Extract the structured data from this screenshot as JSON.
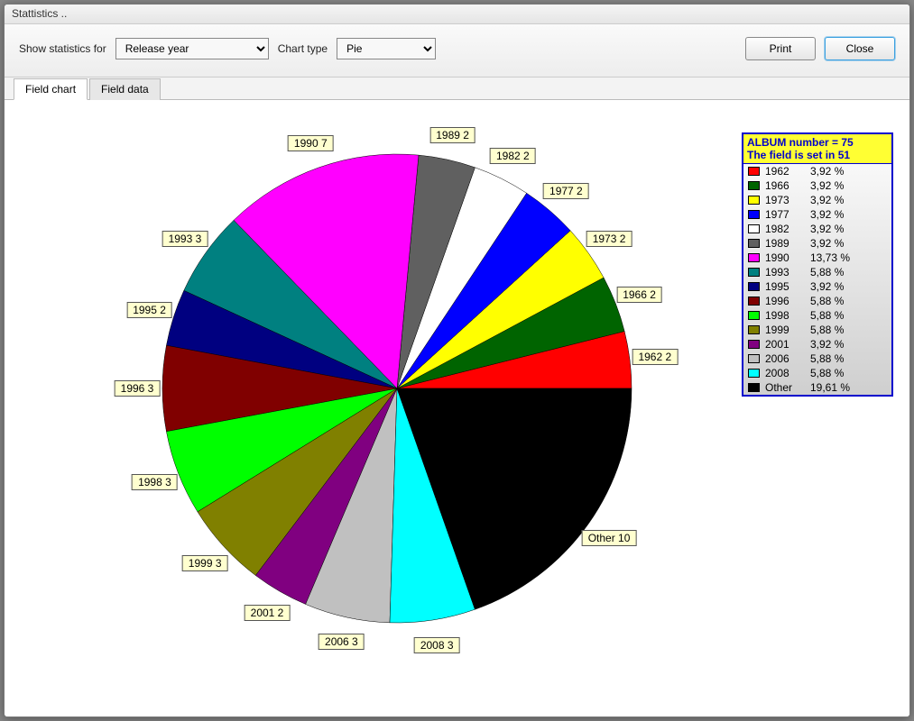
{
  "window": {
    "title": "Stattistics .."
  },
  "toolbar": {
    "stats_label": "Show statistics for",
    "stats_value": "Release year",
    "chart_type_label": "Chart type",
    "chart_type_value": "Pie",
    "print_label": "Print",
    "close_label": "Close"
  },
  "tabs": {
    "chart": "Field chart",
    "data": "Field data"
  },
  "legend_header": {
    "line1": "ALBUM number = 75",
    "line2": "The field is set in 51"
  },
  "chart_data": {
    "type": "pie",
    "title": "",
    "series": [
      {
        "name": "1962",
        "count": 2,
        "percent": "3,92 %",
        "color": "#ff0000"
      },
      {
        "name": "1966",
        "count": 2,
        "percent": "3,92 %",
        "color": "#006400"
      },
      {
        "name": "1973",
        "count": 2,
        "percent": "3,92 %",
        "color": "#ffff00"
      },
      {
        "name": "1977",
        "count": 2,
        "percent": "3,92 %",
        "color": "#0000ff"
      },
      {
        "name": "1982",
        "count": 2,
        "percent": "3,92 %",
        "color": "#ffffff"
      },
      {
        "name": "1989",
        "count": 2,
        "percent": "3,92 %",
        "color": "#606060"
      },
      {
        "name": "1990",
        "count": 7,
        "percent": "13,73 %",
        "color": "#ff00ff"
      },
      {
        "name": "1993",
        "count": 3,
        "percent": "5,88 %",
        "color": "#008080"
      },
      {
        "name": "1995",
        "count": 2,
        "percent": "3,92 %",
        "color": "#000080"
      },
      {
        "name": "1996",
        "count": 3,
        "percent": "5,88 %",
        "color": "#800000"
      },
      {
        "name": "1998",
        "count": 3,
        "percent": "5,88 %",
        "color": "#00ff00"
      },
      {
        "name": "1999",
        "count": 3,
        "percent": "5,88 %",
        "color": "#808000"
      },
      {
        "name": "2001",
        "count": 2,
        "percent": "3,92 %",
        "color": "#800080"
      },
      {
        "name": "2006",
        "count": 3,
        "percent": "5,88 %",
        "color": "#c0c0c0"
      },
      {
        "name": "2008",
        "count": 3,
        "percent": "5,88 %",
        "color": "#00ffff"
      },
      {
        "name": "Other",
        "count": 10,
        "percent": "19,61 %",
        "color": "#000000"
      }
    ]
  }
}
